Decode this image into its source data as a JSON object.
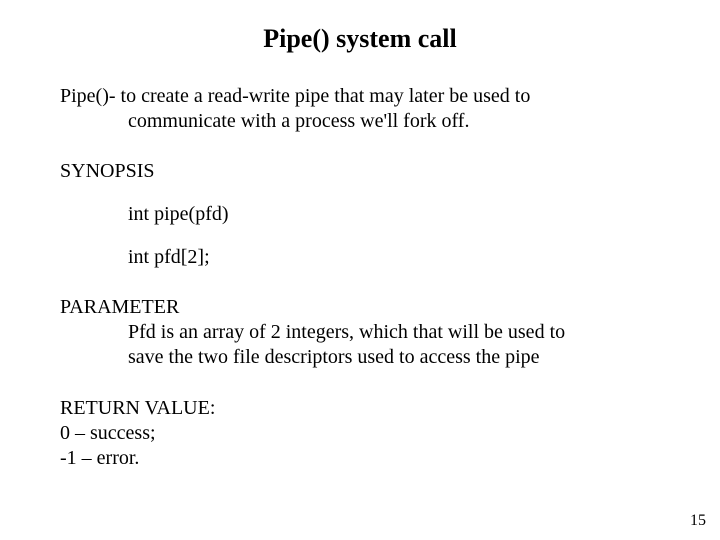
{
  "title": "Pipe() system call",
  "intro": {
    "lead": "Pipe()- to create a read-write pipe that may later be used to",
    "cont": "communicate with a process we'll fork off."
  },
  "synopsis": {
    "label": "SYNOPSIS",
    "line1": "int pipe(pfd)",
    "line2": "int pfd[2];"
  },
  "parameter": {
    "label": "PARAMETER",
    "line1": "Pfd is an array of 2 integers, which that will be used to",
    "line2": "save the two file descriptors used to access the pipe"
  },
  "return_value": {
    "label": "RETURN VALUE:",
    "line1": "0 – success;",
    "line2": "-1 – error."
  },
  "page_number": "15"
}
